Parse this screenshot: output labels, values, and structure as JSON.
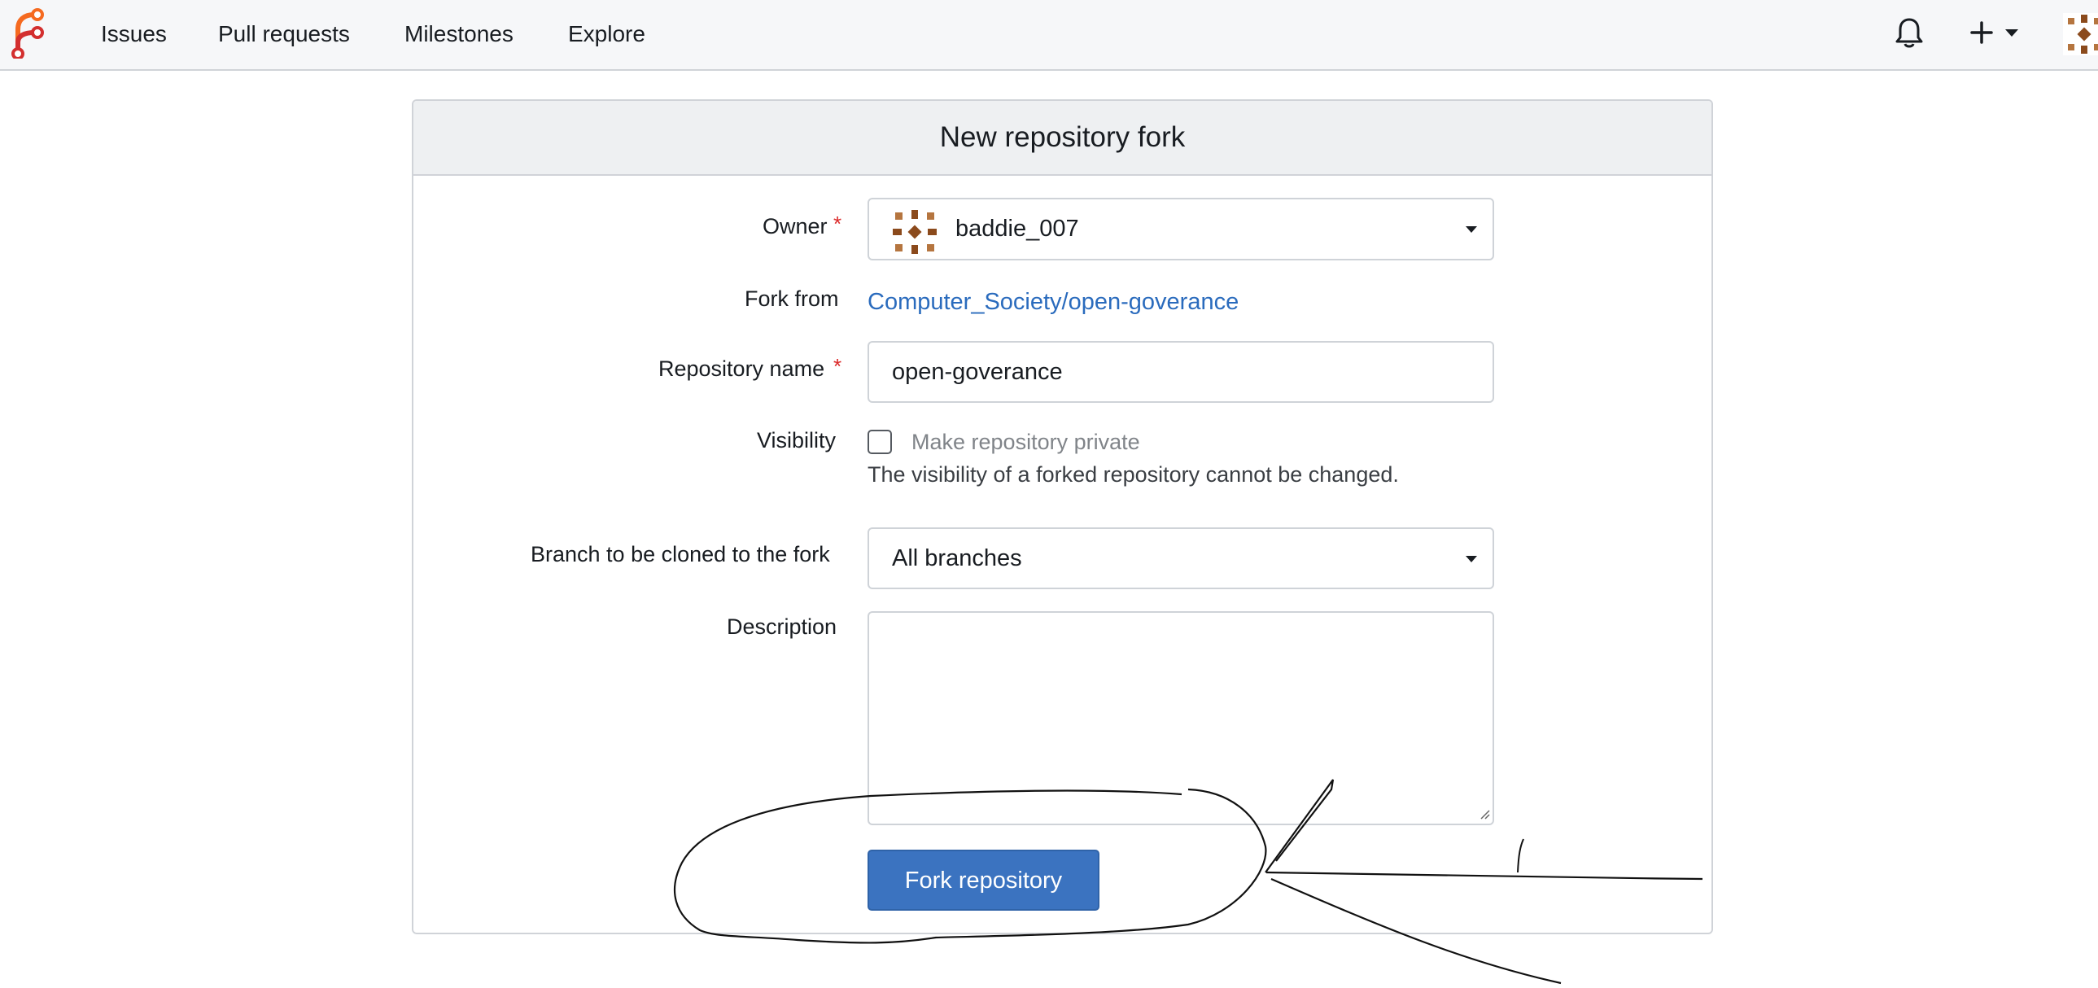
{
  "navbar": {
    "items": [
      {
        "label": "Issues"
      },
      {
        "label": "Pull requests"
      },
      {
        "label": "Milestones"
      },
      {
        "label": "Explore"
      }
    ],
    "icons": [
      "forgejo-logo-icon",
      "bell-icon",
      "plus-icon",
      "chevron-down-icon",
      "avatar"
    ]
  },
  "form": {
    "title": "New repository fork",
    "owner": {
      "label": "Owner",
      "required_mark": "*",
      "value": "baddie_007"
    },
    "fork_from": {
      "label": "Fork from",
      "link": "Computer_Society/open-goverance"
    },
    "repo_name": {
      "label": "Repository name",
      "required_mark": "*",
      "value": "open-goverance"
    },
    "visibility": {
      "label": "Visibility",
      "checkbox_label": "Make repository private",
      "checked": false,
      "help": "The visibility of a forked repository cannot be changed."
    },
    "branch": {
      "label": "Branch to be cloned to the fork",
      "value": "All branches"
    },
    "description": {
      "label": "Description",
      "value": ""
    },
    "submit_label": "Fork repository"
  },
  "colors": {
    "accent": "#3b73c0",
    "link": "#2a6bbd",
    "required": "#db2828",
    "logo_orange": "#f56a20",
    "logo_red": "#d32f2f",
    "avatar_brown": "#8b4a1c"
  }
}
